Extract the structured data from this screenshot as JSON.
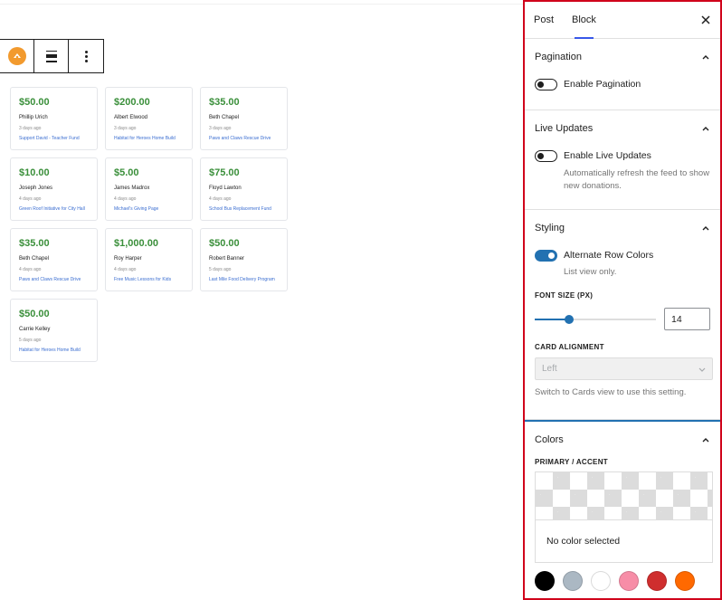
{
  "toolbar": {
    "logo_icon": "donation-feed-logo-icon",
    "align_icon": "align-wide-icon",
    "more_icon": "more-vertical-icon"
  },
  "cards": [
    {
      "amount": "$50.00",
      "name": "Phillip Urich",
      "time": "3 days ago",
      "campaign": "Support David - Teacher Fund"
    },
    {
      "amount": "$200.00",
      "name": "Albert Elwood",
      "time": "3 days ago",
      "campaign": "Habitat for Heroes Home Build"
    },
    {
      "amount": "$35.00",
      "name": "Beth Chapel",
      "time": "3 days ago",
      "campaign": "Paws and Claws Rescue Drive"
    },
    {
      "amount": "$10.00",
      "name": "Joseph Jones",
      "time": "4 days ago",
      "campaign": "Green Roof Initiative for City Hall"
    },
    {
      "amount": "$5.00",
      "name": "James Madrox",
      "time": "4 days ago",
      "campaign": "Michael's Giving Page"
    },
    {
      "amount": "$75.00",
      "name": "Floyd Lawton",
      "time": "4 days ago",
      "campaign": "School Bus Replacement Fund"
    },
    {
      "amount": "$35.00",
      "name": "Beth Chapel",
      "time": "4 days ago",
      "campaign": "Paws and Claws Rescue Drive"
    },
    {
      "amount": "$1,000.00",
      "name": "Roy Harper",
      "time": "4 days ago",
      "campaign": "Free Music Lessons for Kids"
    },
    {
      "amount": "$50.00",
      "name": "Robert Banner",
      "time": "5 days ago",
      "campaign": "Last Mile Food Delivery Program"
    },
    {
      "amount": "$50.00",
      "name": "Carrie Kelley",
      "time": "5 days ago",
      "campaign": "Habitat for Heroes Home Build"
    }
  ],
  "sidebar": {
    "tabs": [
      {
        "label": "Post",
        "active": false
      },
      {
        "label": "Block",
        "active": true
      }
    ],
    "close_icon": "close-icon",
    "pagination": {
      "title": "Pagination",
      "toggle_label": "Enable Pagination",
      "enabled": false
    },
    "live_updates": {
      "title": "Live Updates",
      "toggle_label": "Enable Live Updates",
      "enabled": false,
      "help": "Automatically refresh the feed to show new donations."
    },
    "styling": {
      "title": "Styling",
      "alt_rows_label": "Alternate Row Colors",
      "alt_rows_enabled": true,
      "alt_rows_help": "List view only.",
      "font_size_label": "FONT SIZE (PX)",
      "font_size_value": "14",
      "font_size_fraction": 0.28,
      "card_alignment_label": "CARD ALIGNMENT",
      "card_alignment_value": "Left",
      "card_alignment_help": "Switch to Cards view to use this setting."
    },
    "colors": {
      "title": "Colors",
      "primary_label": "PRIMARY / ACCENT",
      "no_color_text": "No color selected",
      "palette": [
        "#000000",
        "#abb8c3",
        "#ffffff",
        "#f78da7",
        "#cf2e2e",
        "#ff6900"
      ]
    }
  },
  "theme": {
    "accent": "#2271b1",
    "amount_green": "#3a8f3a",
    "link_blue": "#3b6ed1",
    "highlight_border": "#d0021b"
  }
}
